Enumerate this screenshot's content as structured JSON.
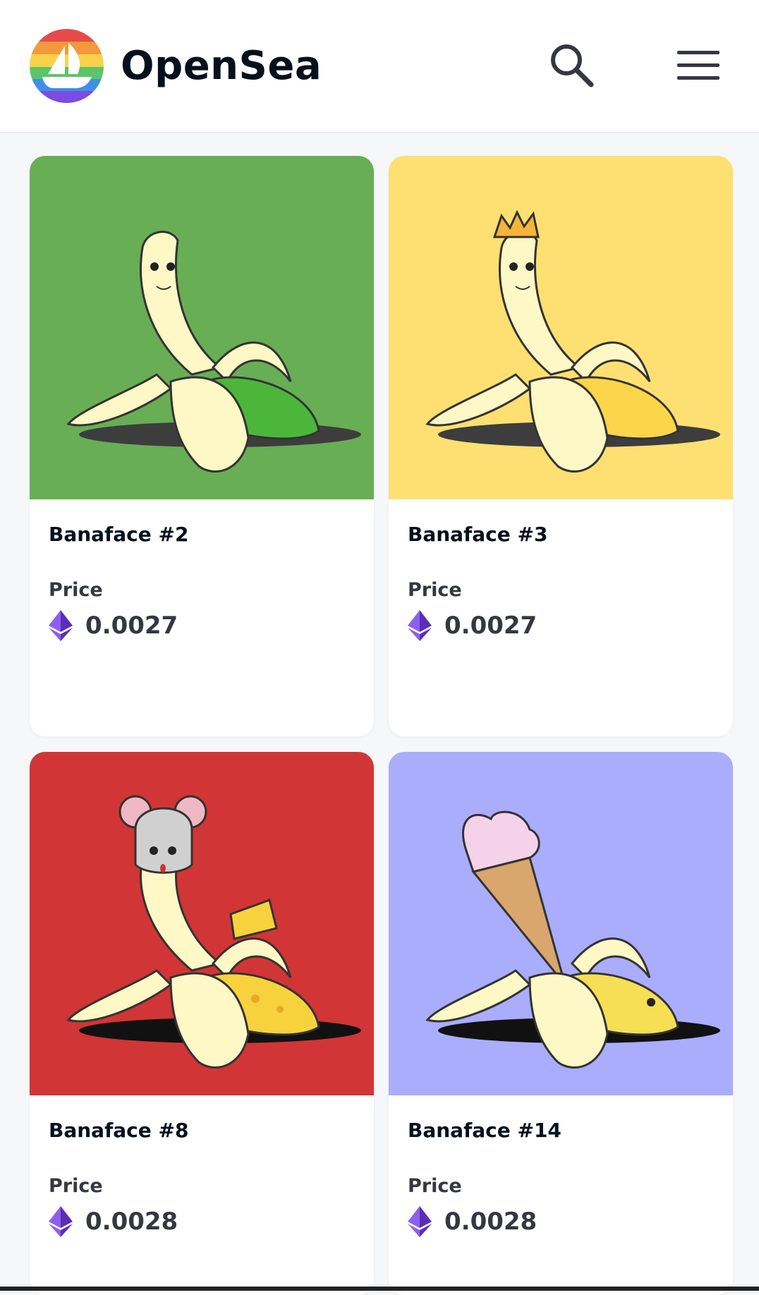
{
  "header": {
    "brand": "OpenSea",
    "logo_icon": "opensea-logo-icon",
    "search_icon": "search-icon",
    "menu_icon": "hamburger-menu-icon"
  },
  "cards": [
    {
      "name": "Banaface #2",
      "price_label": "Price",
      "price": "0.0027",
      "bg": "#68ae55",
      "accessory": "none",
      "peel_color": "#4cb63a"
    },
    {
      "name": "Banaface #3",
      "price_label": "Price",
      "price": "0.0027",
      "bg": "#fde071",
      "accessory": "crown",
      "peel_color": "#fcd54b"
    },
    {
      "name": "Banaface #8",
      "price_label": "Price",
      "price": "0.0028",
      "bg": "#d23535",
      "accessory": "mouse-hat-cheese",
      "peel_color": "#f7d23c"
    },
    {
      "name": "Banaface #14",
      "price_label": "Price",
      "price": "0.0028",
      "bg": "#a9adfb",
      "accessory": "ice-cream-cone",
      "peel_color": "#f6df55"
    }
  ],
  "colors": {
    "header_bg": "#ffffff",
    "page_bg": "#f6f7f8",
    "text_primary": "#04111d",
    "text_secondary": "#353840",
    "eth_purple": "#7b3fe4"
  }
}
